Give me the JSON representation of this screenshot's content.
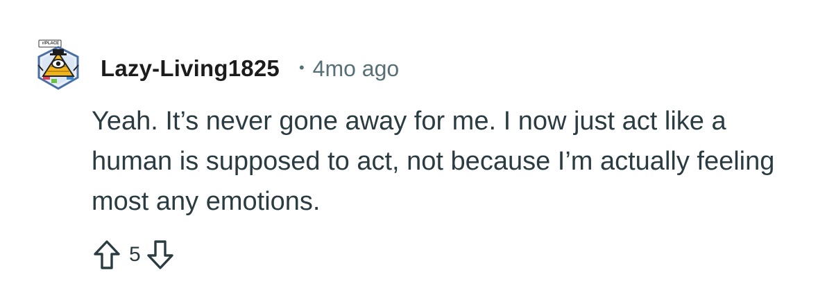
{
  "comment": {
    "author": "Lazy-Living1825",
    "separator": "•",
    "time_ago": "4mo ago",
    "body": "Yeah. It’s never gone away for me. I now just act like a human is supposed to act, not because I’m actually feeling most any emotions.",
    "avatar_badge_text": "r/PLACE",
    "score": "5"
  },
  "icons": {
    "avatar": "pyramid-eye-avatar-icon",
    "upvote": "upvote-arrow-icon",
    "downvote": "downvote-arrow-icon"
  },
  "colors": {
    "text_primary": "#1c1c1c",
    "text_body": "#2a3c42",
    "text_meta": "#576f76",
    "background": "#ffffff"
  }
}
